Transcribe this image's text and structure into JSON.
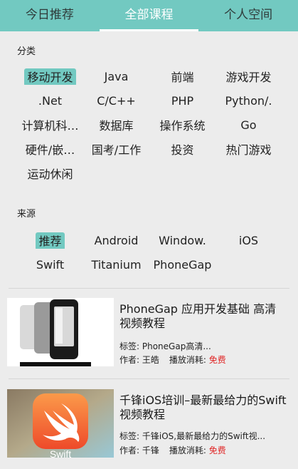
{
  "tabs": [
    {
      "label": "今日推荐"
    },
    {
      "label": "全部课程"
    },
    {
      "label": "个人空间"
    }
  ],
  "active_tab": 1,
  "category": {
    "label": "分类",
    "rows": [
      [
        "移动开发",
        "Java",
        "前端",
        "游戏开发"
      ],
      [
        ".Net",
        "C/C++",
        "PHP",
        "Python/."
      ],
      [
        "计算机科…",
        "数据库",
        "操作系统",
        "Go"
      ],
      [
        "硬件/嵌…",
        "国考/工作",
        "投资",
        "热门游戏"
      ],
      [
        "运动休闲"
      ]
    ],
    "selected": "移动开发"
  },
  "source": {
    "label": "来源",
    "rows": [
      [
        "推荐",
        "Android",
        "Window.",
        "iOS"
      ],
      [
        "Swift",
        "Titanium",
        "PhoneGap"
      ]
    ],
    "selected": "推荐"
  },
  "courses": [
    {
      "title": "PhoneGap 应用开发基础 高清视频教程",
      "tags_label": "标签:",
      "tags": "PhoneGap高清...",
      "author_label": "作者:",
      "author": "王皓",
      "cost_label": "播放消耗:",
      "cost": "免费",
      "thumb_icon": "phonegap-phones-icon"
    },
    {
      "title": "千锋iOS培训–最新最给力的Swift视频教程",
      "tags_label": "标签:",
      "tags": "千锋iOS,最新最给力的Swift视...",
      "author_label": "作者:",
      "author": "千锋",
      "cost_label": "播放消耗:",
      "cost": "免费",
      "thumb_icon": "swift-logo-icon",
      "thumb_text": "Swift"
    }
  ],
  "colors": {
    "accent": "#72c9c1",
    "free": "#e02424",
    "background": "#ececec"
  }
}
